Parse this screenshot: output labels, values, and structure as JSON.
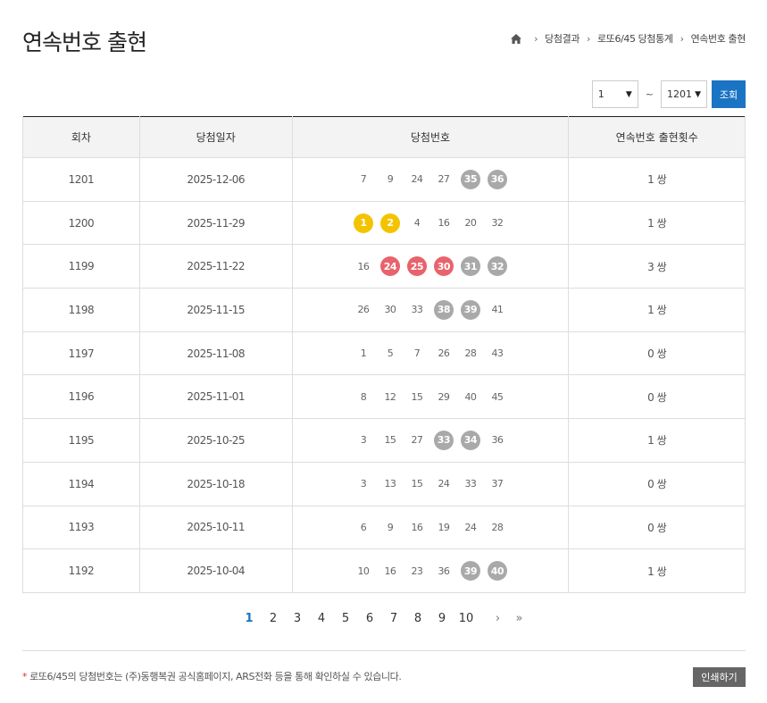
{
  "page": {
    "title": "연속번호 출현"
  },
  "breadcrumb": {
    "items": [
      "당첨결과",
      "로또6/45 당첨통계",
      "연속번호 출현"
    ]
  },
  "filter": {
    "from": "1",
    "tilde": "~",
    "to": "1201",
    "search_label": "조회"
  },
  "colors": {
    "accent": "#1a74c3",
    "yellow": "#f3c300",
    "red": "#e8636b",
    "gray": "#a9a9a9"
  },
  "table": {
    "headers": [
      "회차",
      "당첨일자",
      "당첨번호",
      "연속번호 출현횟수"
    ],
    "rows": [
      {
        "round": "1201",
        "date": "2025-12-06",
        "balls": [
          {
            "n": "7",
            "c": ""
          },
          {
            "n": "9",
            "c": ""
          },
          {
            "n": "24",
            "c": ""
          },
          {
            "n": "27",
            "c": ""
          },
          {
            "n": "35",
            "c": "gray"
          },
          {
            "n": "36",
            "c": "gray"
          }
        ],
        "count": "1 쌍"
      },
      {
        "round": "1200",
        "date": "2025-11-29",
        "balls": [
          {
            "n": "1",
            "c": "yellow"
          },
          {
            "n": "2",
            "c": "yellow"
          },
          {
            "n": "4",
            "c": ""
          },
          {
            "n": "16",
            "c": ""
          },
          {
            "n": "20",
            "c": ""
          },
          {
            "n": "32",
            "c": ""
          }
        ],
        "count": "1 쌍"
      },
      {
        "round": "1199",
        "date": "2025-11-22",
        "balls": [
          {
            "n": "16",
            "c": ""
          },
          {
            "n": "24",
            "c": "red"
          },
          {
            "n": "25",
            "c": "red"
          },
          {
            "n": "30",
            "c": "red"
          },
          {
            "n": "31",
            "c": "gray"
          },
          {
            "n": "32",
            "c": "gray"
          }
        ],
        "count": "3 쌍"
      },
      {
        "round": "1198",
        "date": "2025-11-15",
        "balls": [
          {
            "n": "26",
            "c": ""
          },
          {
            "n": "30",
            "c": ""
          },
          {
            "n": "33",
            "c": ""
          },
          {
            "n": "38",
            "c": "gray"
          },
          {
            "n": "39",
            "c": "gray"
          },
          {
            "n": "41",
            "c": ""
          }
        ],
        "count": "1 쌍"
      },
      {
        "round": "1197",
        "date": "2025-11-08",
        "balls": [
          {
            "n": "1",
            "c": ""
          },
          {
            "n": "5",
            "c": ""
          },
          {
            "n": "7",
            "c": ""
          },
          {
            "n": "26",
            "c": ""
          },
          {
            "n": "28",
            "c": ""
          },
          {
            "n": "43",
            "c": ""
          }
        ],
        "count": "0 쌍"
      },
      {
        "round": "1196",
        "date": "2025-11-01",
        "balls": [
          {
            "n": "8",
            "c": ""
          },
          {
            "n": "12",
            "c": ""
          },
          {
            "n": "15",
            "c": ""
          },
          {
            "n": "29",
            "c": ""
          },
          {
            "n": "40",
            "c": ""
          },
          {
            "n": "45",
            "c": ""
          }
        ],
        "count": "0 쌍"
      },
      {
        "round": "1195",
        "date": "2025-10-25",
        "balls": [
          {
            "n": "3",
            "c": ""
          },
          {
            "n": "15",
            "c": ""
          },
          {
            "n": "27",
            "c": ""
          },
          {
            "n": "33",
            "c": "gray"
          },
          {
            "n": "34",
            "c": "gray"
          },
          {
            "n": "36",
            "c": ""
          }
        ],
        "count": "1 쌍"
      },
      {
        "round": "1194",
        "date": "2025-10-18",
        "balls": [
          {
            "n": "3",
            "c": ""
          },
          {
            "n": "13",
            "c": ""
          },
          {
            "n": "15",
            "c": ""
          },
          {
            "n": "24",
            "c": ""
          },
          {
            "n": "33",
            "c": ""
          },
          {
            "n": "37",
            "c": ""
          }
        ],
        "count": "0 쌍"
      },
      {
        "round": "1193",
        "date": "2025-10-11",
        "balls": [
          {
            "n": "6",
            "c": ""
          },
          {
            "n": "9",
            "c": ""
          },
          {
            "n": "16",
            "c": ""
          },
          {
            "n": "19",
            "c": ""
          },
          {
            "n": "24",
            "c": ""
          },
          {
            "n": "28",
            "c": ""
          }
        ],
        "count": "0 쌍"
      },
      {
        "round": "1192",
        "date": "2025-10-04",
        "balls": [
          {
            "n": "10",
            "c": ""
          },
          {
            "n": "16",
            "c": ""
          },
          {
            "n": "23",
            "c": ""
          },
          {
            "n": "36",
            "c": ""
          },
          {
            "n": "39",
            "c": "gray"
          },
          {
            "n": "40",
            "c": "gray"
          }
        ],
        "count": "1 쌍"
      }
    ]
  },
  "pagination": {
    "pages": [
      "1",
      "2",
      "3",
      "4",
      "5",
      "6",
      "7",
      "8",
      "9",
      "10"
    ],
    "current": "1",
    "next": "›",
    "last": "»"
  },
  "footer": {
    "note": "로또6/45의 당첨번호는 (주)동행복권 공식홈페이지, ARS전화 등을 통해 확인하실 수 있습니다.",
    "star": "*",
    "print_label": "인쇄하기"
  }
}
